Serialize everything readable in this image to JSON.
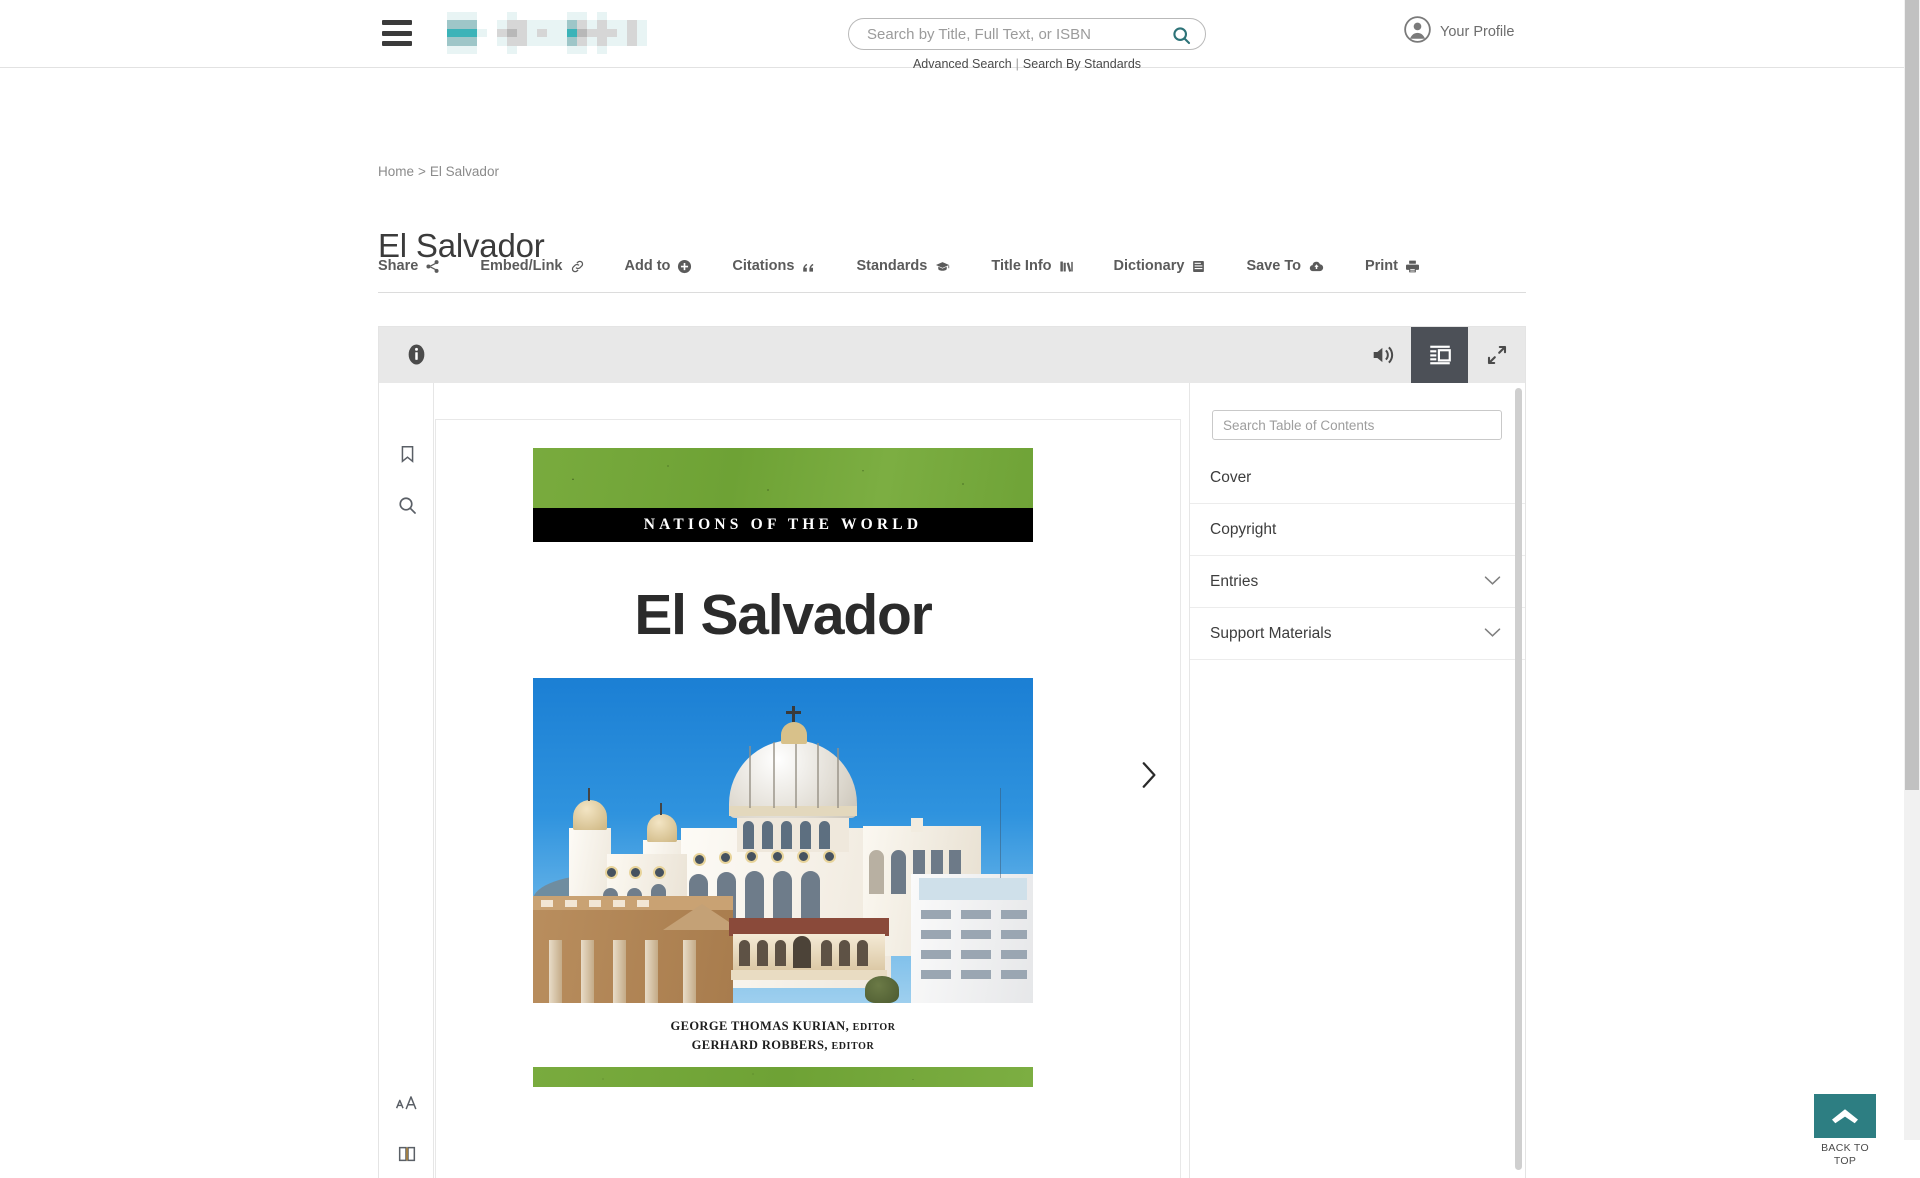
{
  "header": {
    "menu_icon": "hamburger-icon",
    "logo_alt": "site-logo-redacted",
    "logo_colors": [
      "#3bb3b8",
      "#9ec6c8",
      "#b8b8b8",
      "#d6d6d6",
      "#e8f4f4"
    ],
    "search": {
      "placeholder": "Search by Title, Full Text, or ISBN",
      "value": "",
      "icon": "search-icon",
      "advanced_label": "Advanced Search",
      "separator": "|",
      "standards_label": "Search By Standards"
    },
    "profile": {
      "label": "Your Profile",
      "icon": "user-avatar-icon"
    }
  },
  "breadcrumb": {
    "home": "Home",
    "separator": ">",
    "current": "El Salvador"
  },
  "page_title": "El Salvador",
  "toolbar": {
    "items": [
      {
        "label": "Share",
        "icon": "share-icon"
      },
      {
        "label": "Embed/Link",
        "icon": "link-icon"
      },
      {
        "label": "Add to",
        "icon": "plus-circle-icon"
      },
      {
        "label": "Citations",
        "icon": "quote-icon"
      },
      {
        "label": "Standards",
        "icon": "graduation-cap-icon"
      },
      {
        "label": "Title Info",
        "icon": "books-icon"
      },
      {
        "label": "Dictionary",
        "icon": "dictionary-book-icon"
      },
      {
        "label": "Save To",
        "icon": "cloud-upload-icon"
      },
      {
        "label": "Print",
        "icon": "printer-icon"
      }
    ]
  },
  "viewer": {
    "info_icon": "info-icon",
    "audio_icon": "speaker-icon",
    "toc_icon": "table-of-contents-icon",
    "expand_icon": "expand-arrows-icon",
    "active_tool": "table-of-contents-icon",
    "active_tool_bg": "#4c5057",
    "rail": [
      {
        "name": "bookmark-icon"
      },
      {
        "name": "search-icon"
      },
      {
        "name": "font-size-icon",
        "glyph": "aA"
      },
      {
        "name": "page-spread-icon"
      }
    ],
    "next_page_icon": "chevron-right-icon"
  },
  "cover": {
    "series": "NATIONS OF THE WORLD",
    "title": "El Salvador",
    "photo_alt": "Metropolitan Cathedral of San Salvador",
    "credits": [
      {
        "name": "GEORGE THOMAS KURIAN,",
        "role": "EDITOR"
      },
      {
        "name": "GERHARD ROBBERS,",
        "role": "EDITOR"
      }
    ],
    "band_color": "#79ab3e"
  },
  "toc": {
    "search_placeholder": "Search Table of Contents",
    "search_value": "",
    "items": [
      {
        "label": "Cover",
        "expandable": false
      },
      {
        "label": "Copyright",
        "expandable": false
      },
      {
        "label": "Entries",
        "expandable": true
      },
      {
        "label": "Support Materials",
        "expandable": true
      }
    ],
    "chevron_icon": "chevron-down-icon"
  },
  "back_to_top": {
    "label": "BACK TO\nTOP",
    "line1": "BACK TO",
    "line2": "TOP",
    "icon": "chevron-up-icon",
    "color": "#2d7e82"
  }
}
